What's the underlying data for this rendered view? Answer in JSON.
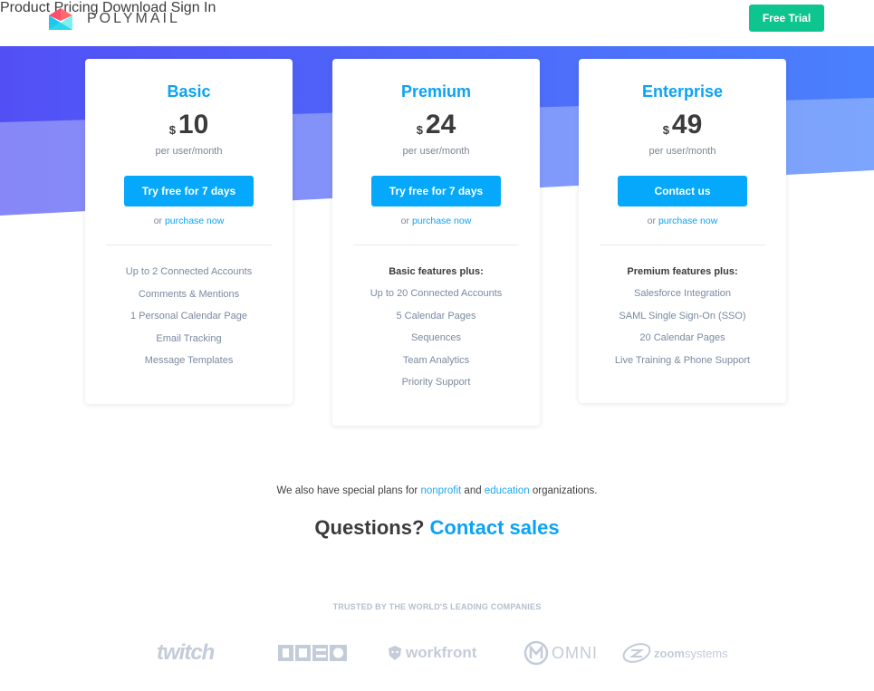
{
  "header": {
    "brand": "POLYMAIL",
    "nav": [
      "Product",
      "Pricing",
      "Download",
      "Sign In"
    ],
    "cta": "Free Trial"
  },
  "plans": [
    {
      "name": "Basic",
      "currency": "$",
      "price": "10",
      "period": "per user/month",
      "cta": "Try free for 7 days",
      "or_text": "or",
      "link": "purchase now",
      "features_heading": "",
      "features": [
        "Up to 2 Connected Accounts",
        "Comments & Mentions",
        "1 Personal Calendar Page",
        "Email Tracking",
        "Message Templates"
      ]
    },
    {
      "name": "Premium",
      "currency": "$",
      "price": "24",
      "period": "per user/month",
      "cta": "Try free for 7 days",
      "or_text": "or",
      "link": "purchase now",
      "features_heading": "Basic features plus:",
      "features": [
        "Up to 20 Connected Accounts",
        "5 Calendar Pages",
        "Sequences",
        "Team Analytics",
        "Priority Support"
      ]
    },
    {
      "name": "Enterprise",
      "currency": "$",
      "price": "49",
      "period": "per user/month",
      "cta": "Contact us",
      "or_text": "or",
      "link": "purchase now",
      "features_heading": "Premium features plus:",
      "features": [
        "Salesforce Integration",
        "SAML Single Sign-On (SSO)",
        "20 Calendar Pages",
        "Live Training & Phone Support"
      ]
    }
  ],
  "special": {
    "prefix": "We also have special plans for",
    "link1": "nonprofit",
    "mid": "and",
    "link2": "education",
    "suffix": "organizations."
  },
  "questions": {
    "text": "Questions?",
    "link": "Contact sales"
  },
  "trusted": {
    "heading": "TRUSTED BY THE WORLD'S LEADING COMPANIES",
    "logos": [
      "twitch",
      "IDEO",
      "workfront",
      "OMNI",
      "zoomsystems"
    ]
  },
  "colors": {
    "accent": "#0aa3f5",
    "cta_green": "#0fc58f",
    "button_blue": "#05a8fa",
    "band_dark_left": "#5250f5",
    "band_dark_right": "#4a80fd",
    "band_light_left": "#8787f7",
    "band_light_right": "#7ca5fd"
  }
}
